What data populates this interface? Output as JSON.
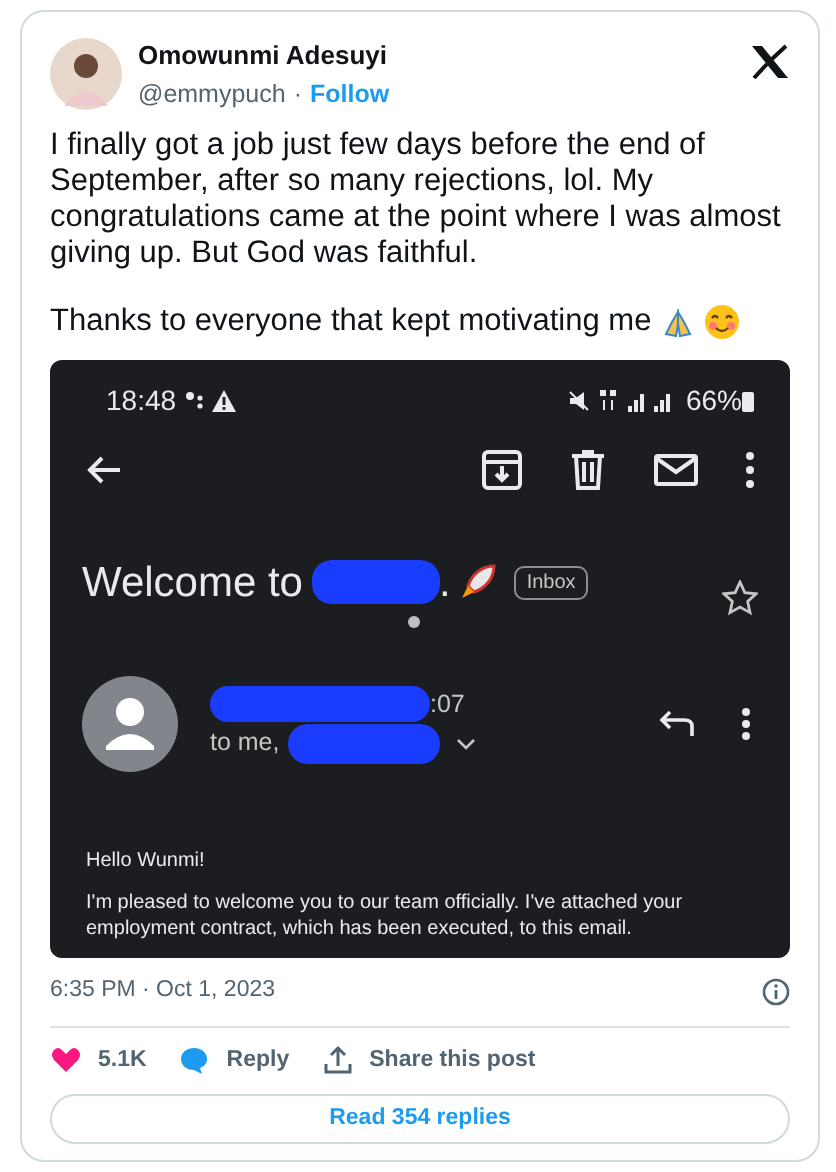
{
  "author": {
    "name": "Omowunmi Adesuyi",
    "handle": "@emmypuch",
    "separator": "·",
    "follow": "Follow"
  },
  "paragraphs": [
    "I finally got a job just few days before the end of September, after so many rejections, lol. My congratulations came at the point where I was almost giving up. But God was faithful.",
    "Thanks to everyone that kept motivating me"
  ],
  "screenshot": {
    "status_bar": {
      "time": "18:48",
      "battery": "66%"
    },
    "subject": "Welcome to",
    "subject_end": ".",
    "label": "Inbox",
    "sender_time": ":07",
    "recipients": "to me,",
    "greeting": "Hello Wunmi!",
    "body": "I'm pleased to welcome you to our team officially. I've attached your employment contract, which has been executed, to this email."
  },
  "timestamp": "6:35 PM · Oct 1, 2023",
  "actions": [
    {
      "kind": "like",
      "label": "5.1K"
    },
    {
      "kind": "reply",
      "label": "Reply"
    },
    {
      "kind": "share",
      "label": "Share this post"
    }
  ],
  "read_replies": "Read 354 replies"
}
